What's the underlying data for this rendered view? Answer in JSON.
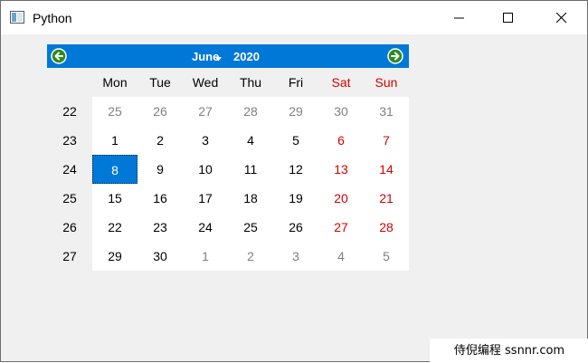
{
  "window": {
    "title": "Python"
  },
  "calendar": {
    "month": "June",
    "year": "2020",
    "weekday_headers": [
      "Mon",
      "Tue",
      "Wed",
      "Thu",
      "Fri",
      "Sat",
      "Sun"
    ],
    "weeks": [
      {
        "week": "22",
        "days": [
          "25",
          "26",
          "27",
          "28",
          "29",
          "30",
          "31"
        ]
      },
      {
        "week": "23",
        "days": [
          "1",
          "2",
          "3",
          "4",
          "5",
          "6",
          "7"
        ]
      },
      {
        "week": "24",
        "days": [
          "8",
          "9",
          "10",
          "11",
          "12",
          "13",
          "14"
        ]
      },
      {
        "week": "25",
        "days": [
          "15",
          "16",
          "17",
          "18",
          "19",
          "20",
          "21"
        ]
      },
      {
        "week": "26",
        "days": [
          "22",
          "23",
          "24",
          "25",
          "26",
          "27",
          "28"
        ]
      },
      {
        "week": "27",
        "days": [
          "29",
          "30",
          "1",
          "2",
          "3",
          "4",
          "5"
        ]
      }
    ],
    "selected_day": "8"
  },
  "watermark": {
    "text": "侍倪编程 ssnnr.com"
  },
  "colors": {
    "accent": "#0078d7",
    "weekend": "#d40000",
    "other_month": "#808080",
    "nav_arrow": "#2e8b1e"
  },
  "icons": [
    "app-icon",
    "minimize-icon",
    "maximize-icon",
    "close-icon",
    "previous-month-icon",
    "next-month-icon",
    "month-dropdown-icon"
  ]
}
